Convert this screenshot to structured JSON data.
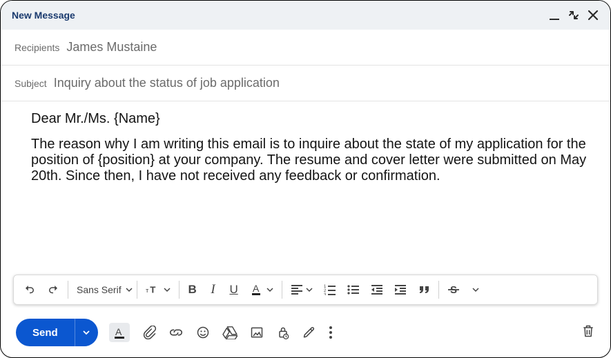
{
  "window": {
    "title": "New Message"
  },
  "recipients": {
    "label": "Recipients",
    "value": "James Mustaine"
  },
  "subject": {
    "label": "Subject",
    "value": "Inquiry about the status of job application"
  },
  "body": {
    "greeting": "Dear Mr./Ms. {Name}",
    "para1": "The reason why I am writing this email is to inquire about the state of my application for the position of {position} at your company. The resume and cover letter were submitted on May 20th. Since then, I have not received any feedback or confirmation."
  },
  "toolbar": {
    "font_name": "Sans Serif"
  },
  "actions": {
    "send_label": "Send"
  }
}
